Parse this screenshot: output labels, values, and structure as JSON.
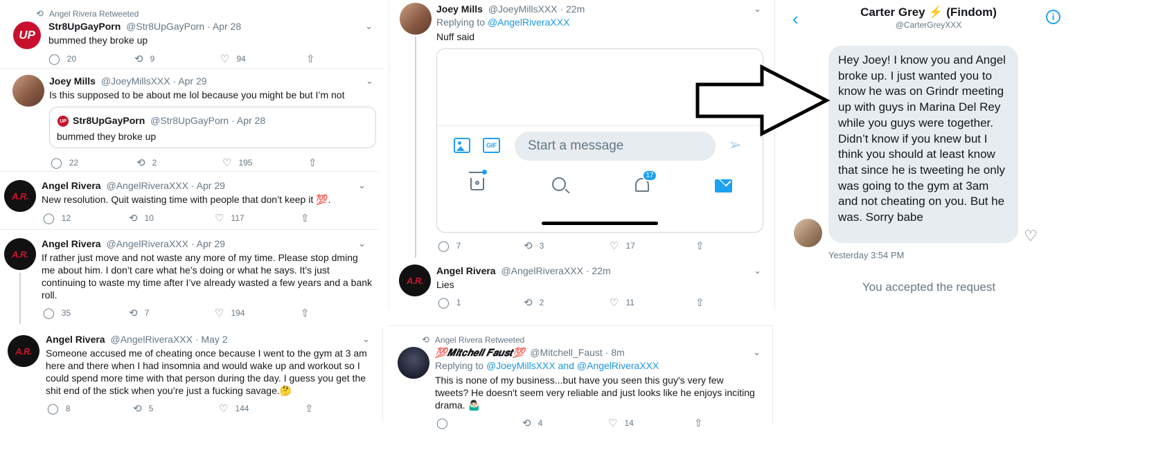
{
  "left_column": {
    "t1": {
      "retweet_label": "Angel Rivera Retweeted",
      "name": "Str8UpGayPorn",
      "handle": "@Str8UpGayPorn",
      "date": "· Apr 28",
      "text": "bummed they broke up",
      "avatar": "UP",
      "replies": "20",
      "retweets": "9",
      "likes": "94"
    },
    "t2": {
      "name": "Joey Mills",
      "handle": "@JoeyMillsXXX",
      "date": "· Apr 29",
      "text": "Is this supposed to be about me lol because you might be but I’m not",
      "quote": {
        "name": "Str8UpGayPorn",
        "handle": "@Str8UpGayPorn",
        "date": "· Apr 28",
        "text": "bummed they broke up"
      },
      "replies": "22",
      "retweets": "2",
      "likes": "195"
    },
    "t3": {
      "name": "Angel Rivera",
      "handle": "@AngelRiveraXXX",
      "date": "· Apr 29",
      "text": "New resolution. Quit waisting time with people that don’t keep it 💯.",
      "avatar": "A.R.",
      "replies": "12",
      "retweets": "10",
      "likes": "117"
    },
    "t4": {
      "name": "Angel Rivera",
      "handle": "@AngelRiveraXXX",
      "date": "· Apr 29",
      "text": "If rather just move and not waste any more of my time. Please stop dming me about him. I don’t care what he’s doing or what he says. It’s just continuing to waste my time after I’ve already wasted a few years and a bank roll.",
      "avatar": "A.R.",
      "replies": "35",
      "retweets": "7",
      "likes": "194"
    },
    "t5": {
      "name": "Angel Rivera",
      "handle": "@AngelRiveraXXX",
      "date": "· May 2",
      "text": "Someone accused me of cheating once because I went to the gym at 3 am here and there when I had insomnia and would wake up and workout so I could spend more time with that person during the day. I guess you get the shit end of the stick when you’re just a fucking savage.🤔",
      "avatar": "A.R.",
      "replies": "8",
      "retweets": "5",
      "likes": "144"
    }
  },
  "middle_column": {
    "t1": {
      "name": "Joey Mills",
      "handle": "@JoeyMillsXXX",
      "date": "· 22m",
      "replying_prefix": "Replying to ",
      "replying_to": "@AngelRiveraXXX",
      "text": "Nuff said",
      "message_placeholder": "Start a message",
      "notif_count": "17",
      "replies": "7",
      "retweets": "3",
      "likes": "17"
    },
    "t2": {
      "name": "Angel Rivera",
      "handle": "@AngelRiveraXXX",
      "date": "· 22m",
      "text": "Lies",
      "avatar": "A.R.",
      "replies": "1",
      "retweets": "2",
      "likes": "11"
    },
    "t3": {
      "retweet_label": "Angel Rivera Retweeted",
      "name": "💯𝑴𝒊𝒕𝒄𝒉𝒆𝒍𝒍 𝑭𝒂𝒖𝒔𝒕💯",
      "handle": "@Mitchell_Faust",
      "date": "· 8m",
      "replying_prefix": "Replying to ",
      "replying_to": "@JoeyMillsXXX and @AngelRiveraXXX",
      "text": "This is none of my business...but have you seen this guy's very few tweets? He doesn't seem very reliable and just looks like he enjoys inciting drama. 🤷🏻‍♂️",
      "replies": "",
      "retweets": "4",
      "likes": "14"
    }
  },
  "right_column": {
    "title": "Carter Grey ⚡️ (Findom)",
    "handle": "@CarterGreyXXX",
    "message": "Hey Joey! I know you and Angel broke up. I just wanted you to know he was on Grindr meeting up with guys in Marina Del Rey while you guys were together. Didn’t know if you knew but I think you should at least know that since he is tweeting he only was going to the gym at 3am and not cheating on you. But he was. Sorry babe",
    "timestamp": "Yesterday 3:54 PM",
    "accepted": "You accepted the request"
  },
  "icons": {
    "reply": "reply-icon",
    "retweet": "retweet-icon",
    "like": "heart-icon",
    "share": "share-icon",
    "chevron": "chevron-down-icon",
    "back": "back-icon",
    "info": "info-icon",
    "image": "image-icon",
    "gif": "gif-icon",
    "send": "send-icon",
    "home": "home-icon",
    "search": "search-icon",
    "notifications": "bell-icon",
    "messages": "mail-icon",
    "arrow": "arrow-right-icon",
    "heart_add": "heart-add-icon"
  },
  "colors": {
    "link": "#1b95e0",
    "muted": "#657786",
    "bubble": "#e6ecf0",
    "accent": "#1da1f2"
  }
}
